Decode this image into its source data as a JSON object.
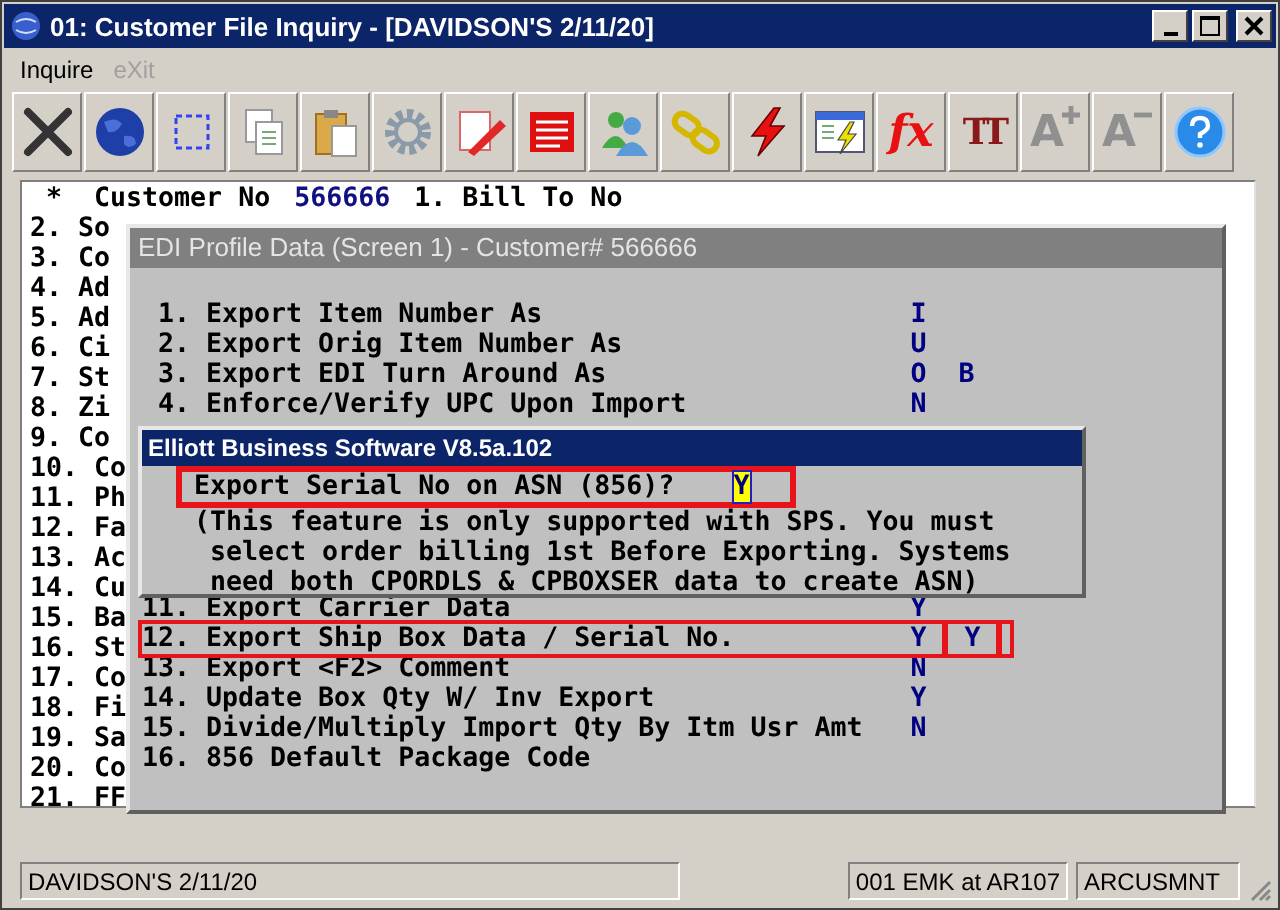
{
  "window": {
    "title": "01: Customer File Inquiry - [DAVIDSON'S 2/11/20]"
  },
  "menu": [
    {
      "label": "Inquire",
      "disabled": false
    },
    {
      "label": "eXit",
      "disabled": true
    }
  ],
  "toolbar": [
    {
      "kind": "close"
    },
    {
      "kind": "globe"
    },
    {
      "kind": "select"
    },
    {
      "kind": "copy"
    },
    {
      "kind": "paste"
    },
    {
      "kind": "gear"
    },
    {
      "kind": "edit"
    },
    {
      "kind": "form"
    },
    {
      "kind": "users"
    },
    {
      "kind": "chain"
    },
    {
      "kind": "bolt"
    },
    {
      "kind": "window-bolt"
    },
    {
      "kind": "glyph",
      "label": "fx"
    },
    {
      "kind": "fonts",
      "label": "TT"
    },
    {
      "kind": "grow",
      "label": "A"
    },
    {
      "kind": "shrink",
      "label": "A"
    },
    {
      "kind": "help"
    }
  ],
  "customer": {
    "star": "*",
    "label": "Customer No",
    "value": "566666",
    "next": "1. Bill To No"
  },
  "fields": [
    "2. So",
    "3. Co",
    "4. Ad",
    "5. Ad",
    "6. Ci",
    "7. St",
    "8. Zi",
    "9. Co",
    "10. Co",
    "11. Ph",
    "12. Fa",
    "13. Ac",
    "14. Cu",
    "15. Ba",
    "16. St",
    "17. Co",
    "18. Fi",
    "19. Sa",
    "20. Co",
    "21. FF"
  ],
  "edi_dialog": {
    "title": "EDI Profile Data (Screen 1) - Customer# 566666",
    "upper_items": [
      {
        "number": "1.",
        "label": "Export Item Number As",
        "value": "I",
        "highlighted": false
      },
      {
        "number": "2.",
        "label": "Export Orig Item Number As",
        "value": "U",
        "highlighted": false
      },
      {
        "number": "3.",
        "label": "Export EDI Turn Around As",
        "value": "O",
        "value_2": "B",
        "highlighted": false
      },
      {
        "number": "4.",
        "label": "Enforce/Verify UPC Upon Import",
        "value": "N",
        "highlighted": false
      }
    ],
    "lower_items": [
      {
        "number": "11.",
        "label": "Export Carrier Data",
        "value": "Y",
        "highlighted": false
      },
      {
        "number": "12.",
        "label": "Export Ship Box Data / Serial No.",
        "value": "Y",
        "value_2": "Y",
        "highlighted": true
      },
      {
        "number": "13.",
        "label": "Export <F2> Comment",
        "value": "N",
        "highlighted": false
      },
      {
        "number": "14.",
        "label": "Update Box Qty W/ Inv Export",
        "value": "Y",
        "highlighted": false
      },
      {
        "number": "15.",
        "label": "Divide/Multiply Import Qty By Itm Usr Amt",
        "value": "N",
        "highlighted": false
      },
      {
        "number": "16.",
        "label": "856 Default Package Code",
        "highlighted": false
      }
    ]
  },
  "prompt_dialog": {
    "title": "Elliott Business Software V8.5a.102",
    "question": "Export Serial No on ASN (856)?",
    "answer": "Y",
    "highlighted": true,
    "note": "(This feature is only supported with SPS. You must\n select order billing 1st Before Exporting. Systems\n need both CPORDLS & CPBOXSER data to create ASN)"
  },
  "status_bar": [
    "DAVIDSON'S 2/11/20",
    "001 EMK at AR107",
    "ARCUSMNT"
  ]
}
